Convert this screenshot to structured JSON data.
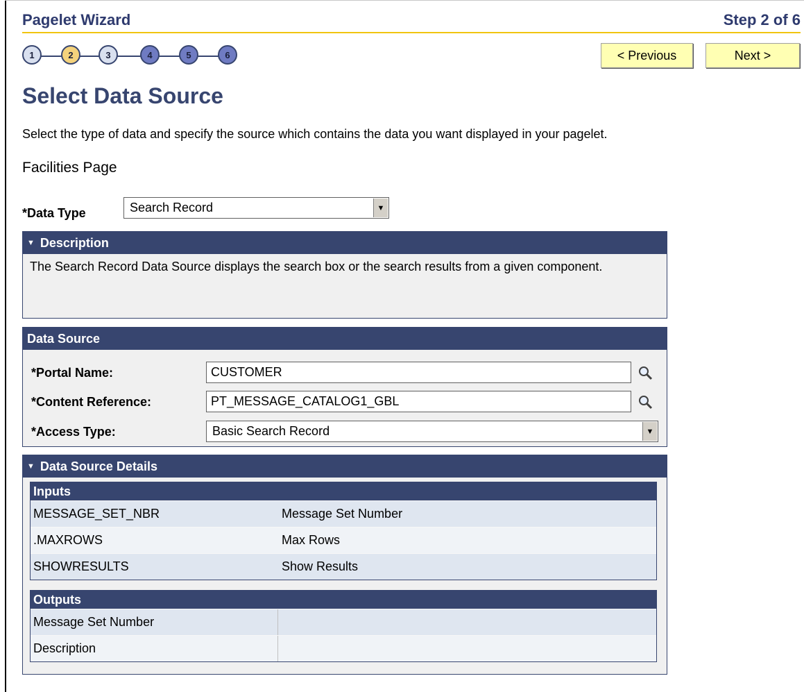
{
  "header": {
    "title": "Pagelet Wizard",
    "step": "Step 2 of 6"
  },
  "steps": [
    "1",
    "2",
    "3",
    "4",
    "5",
    "6"
  ],
  "buttons": {
    "previous": "< Previous",
    "next": "Next >"
  },
  "page": {
    "title": "Select Data Source",
    "instruction": "Select the type of data and specify the source which contains the data you want displayed in your pagelet.",
    "subtitle": "Facilities Page"
  },
  "data_type": {
    "label": "*Data Type",
    "value": "Search Record"
  },
  "description": {
    "header": "Description",
    "text": "The Search Record Data Source displays the search box or the search results from a given component."
  },
  "data_source": {
    "header": "Data Source",
    "portal_label": "*Portal Name:",
    "portal_value": "CUSTOMER",
    "content_ref_label": "*Content Reference:",
    "content_ref_value": "PT_MESSAGE_CATALOG1_GBL",
    "access_type_label": "*Access Type:",
    "access_type_value": "Basic Search Record"
  },
  "details": {
    "header": "Data Source Details",
    "inputs_header": "Inputs",
    "inputs": [
      {
        "name": "MESSAGE_SET_NBR",
        "desc": "Message Set Number"
      },
      {
        "name": ".MAXROWS",
        "desc": "Max Rows"
      },
      {
        "name": "SHOWRESULTS",
        "desc": "Show Results"
      }
    ],
    "outputs_header": "Outputs",
    "outputs": [
      {
        "name": "Message Set Number",
        "desc": ""
      },
      {
        "name": "Description",
        "desc": ""
      }
    ]
  }
}
